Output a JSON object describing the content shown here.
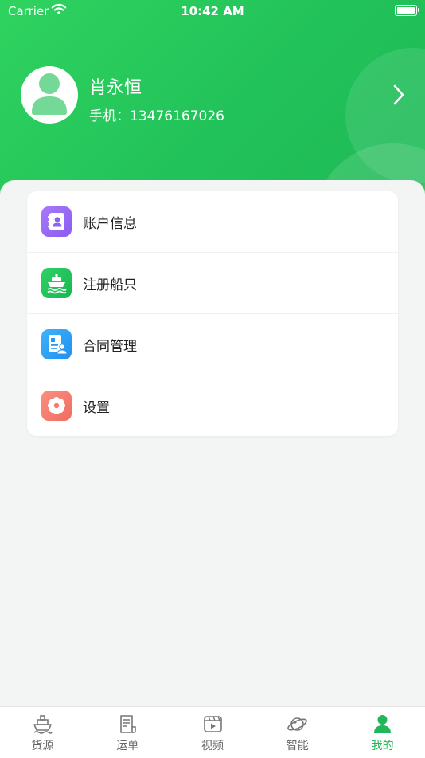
{
  "status_bar": {
    "carrier": "Carrier",
    "time": "10:42 AM"
  },
  "profile": {
    "name": "肖永恒",
    "phone": "手机：13476167026"
  },
  "menu": {
    "items": [
      {
        "label": "账户信息",
        "icon": "contact-card-icon",
        "color": "#9b6cf6"
      },
      {
        "label": "注册船只",
        "icon": "ship-icon",
        "color": "#22c25a"
      },
      {
        "label": "合同管理",
        "icon": "contract-icon",
        "color": "#2f9cf5"
      },
      {
        "label": "设置",
        "icon": "gear-flower-icon",
        "color": "#f47e6e"
      }
    ]
  },
  "tabbar": {
    "tabs": [
      {
        "label": "货源",
        "icon": "cargo-ship-icon"
      },
      {
        "label": "运单",
        "icon": "waybill-icon"
      },
      {
        "label": "视频",
        "icon": "video-icon"
      },
      {
        "label": "智能",
        "icon": "planet-icon"
      },
      {
        "label": "我的",
        "icon": "person-icon",
        "active": true
      }
    ]
  },
  "colors": {
    "brand_green": "#22c25a",
    "active_tab": "#22b65a",
    "inactive_tab": "#666666"
  }
}
